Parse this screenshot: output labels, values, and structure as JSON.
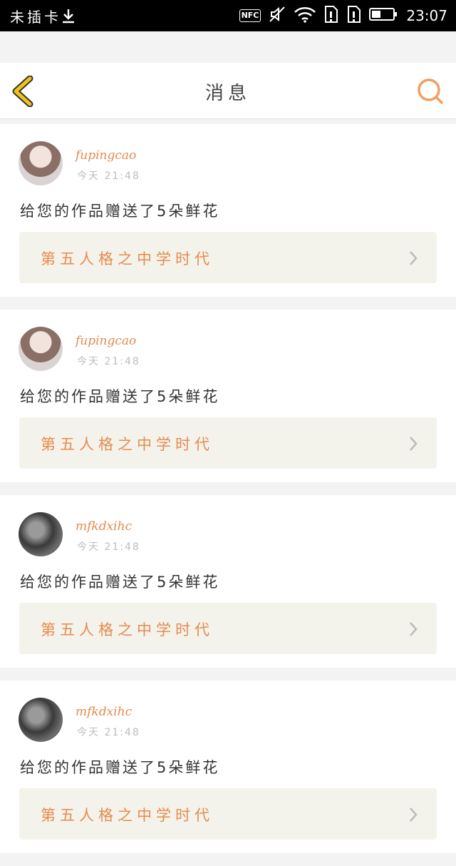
{
  "status_bar": {
    "carrier": "未插卡",
    "nfc": "NFC",
    "time": "23:07",
    "icons": [
      "download-icon",
      "nfc-icon",
      "mute-icon",
      "wifi-icon",
      "sim-icon",
      "sim2-icon",
      "battery-icon"
    ]
  },
  "header": {
    "title": "消息",
    "back_icon": "chevron-left-icon",
    "search_icon": "search-icon",
    "accent_color": "#f2c21b",
    "search_color": "#f0a060"
  },
  "notifications": [
    {
      "username": "fupingcao",
      "time": "今天 21:48",
      "message": "给您的作品赠送了5朵鲜花",
      "work_title": "第五人格之中学时代",
      "avatar": "type-a"
    },
    {
      "username": "fupingcao",
      "time": "今天 21:48",
      "message": "给您的作品赠送了5朵鲜花",
      "work_title": "第五人格之中学时代",
      "avatar": "type-a"
    },
    {
      "username": "mfkdxihc",
      "time": "今天 21:48",
      "message": "给您的作品赠送了5朵鲜花",
      "work_title": "第五人格之中学时代",
      "avatar": "type-b"
    },
    {
      "username": "mfkdxihc",
      "time": "今天 21:48",
      "message": "给您的作品赠送了5朵鲜花",
      "work_title": "第五人格之中学时代",
      "avatar": "type-b"
    }
  ]
}
